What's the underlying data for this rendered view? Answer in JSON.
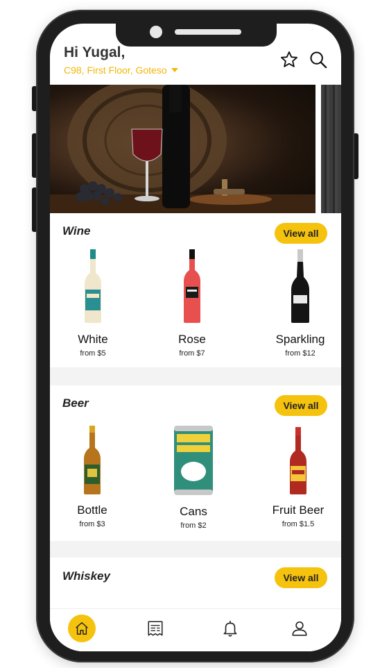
{
  "header": {
    "greeting": "Hi Yugal,",
    "address": "C98, First Floor, Goteso"
  },
  "icons": {
    "favorites": "star-icon",
    "search": "search-icon",
    "dropdown": "caret-down-icon"
  },
  "sections": {
    "wine": {
      "title": "Wine",
      "view_all": "View all",
      "items": [
        {
          "name": "White",
          "price": "from $5"
        },
        {
          "name": "Rose",
          "price": "from $7"
        },
        {
          "name": "Sparkling",
          "price": "from $12"
        }
      ]
    },
    "beer": {
      "title": "Beer",
      "view_all": "View all",
      "items": [
        {
          "name": "Bottle",
          "price": "from $3"
        },
        {
          "name": "Cans",
          "price": "from $2"
        },
        {
          "name": "Fruit Beer",
          "price": "from $1.5"
        }
      ]
    },
    "whiskey": {
      "title": "Whiskey",
      "view_all": "View all"
    }
  },
  "nav": {
    "items": [
      "home-icon",
      "receipt-icon",
      "bell-icon",
      "user-icon"
    ],
    "active": "home-icon"
  },
  "colors": {
    "accent": "#f5c20e",
    "address": "#f2b705",
    "frame": "#1e1e1e"
  }
}
